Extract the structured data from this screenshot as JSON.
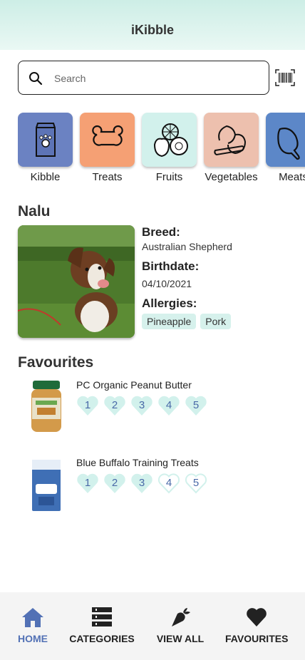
{
  "app": {
    "title": "iKibble"
  },
  "search": {
    "placeholder": "Search",
    "icon": "search-icon",
    "scan_icon": "barcode-scan-icon"
  },
  "categories": [
    {
      "label": "Kibble",
      "color": "#6b82c2",
      "icon": "kibble-bag-icon"
    },
    {
      "label": "Treats",
      "color": "#f5a074",
      "icon": "bone-icon"
    },
    {
      "label": "Fruits",
      "color": "#d2f1ec",
      "icon": "fruits-icon"
    },
    {
      "label": "Vegetables",
      "color": "#edc0ae",
      "icon": "vegetables-icon"
    },
    {
      "label": "Meats",
      "color": "#5c87c8",
      "icon": "drumstick-icon"
    }
  ],
  "pet": {
    "name": "Nalu",
    "breed_label": "Breed:",
    "breed": "Australian Shepherd",
    "birthdate_label": "Birthdate:",
    "birthdate": "04/10/2021",
    "allergies_label": "Allergies:",
    "allergies": [
      "Pineapple",
      "Pork"
    ]
  },
  "favourites": {
    "title": "Favourites",
    "items": [
      {
        "name": "PC Organic Peanut Butter",
        "rating": 5,
        "ratings": [
          "1",
          "2",
          "3",
          "4",
          "5"
        ]
      },
      {
        "name": "Blue Buffalo Training Treats",
        "rating": 3,
        "ratings": [
          "1",
          "2",
          "3",
          "4",
          "5"
        ]
      }
    ]
  },
  "tabbar": {
    "items": [
      {
        "label": "HOME",
        "icon": "home-icon",
        "active": true
      },
      {
        "label": "CATEGORIES",
        "icon": "categories-icon",
        "active": false
      },
      {
        "label": "VIEW ALL",
        "icon": "carrot-icon",
        "active": false
      },
      {
        "label": "FAVOURITES",
        "icon": "heart-icon",
        "active": false
      }
    ]
  },
  "colors": {
    "accent": "#5271b5",
    "heart_fill": "#d2f1ec",
    "header_bg": "#d9f3ed"
  }
}
